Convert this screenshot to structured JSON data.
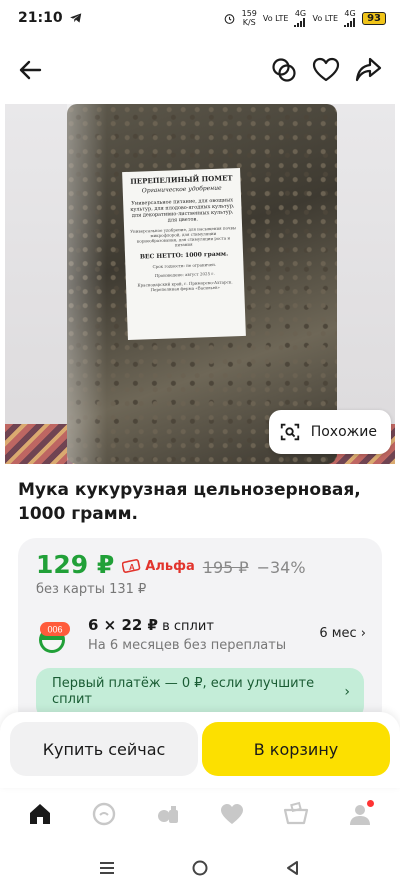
{
  "status_bar": {
    "time": "21:10",
    "net_speed": "159",
    "net_unit": "K/S",
    "sim1": "Vo LTE",
    "sim1_gen": "4G",
    "sim2": "Vo LTE",
    "sim2_gen": "4G",
    "battery": "93"
  },
  "header": {
    "back_icon": "arrow-left-icon",
    "compare_icon": "compare-icon",
    "favorite_icon": "heart-icon",
    "share_icon": "share-icon"
  },
  "product_image": {
    "label_title": "ПЕРЕПЕЛИНЫЙ ПОМЕТ",
    "label_subtitle": "Органическое удобрение",
    "label_body": "Универсальное питание, для овощных культур, для плодово-ягодных культур, для декоративно-лиственных культур, для цветов.",
    "label_small": "Универсальное удобрение, для насыщения почвы микрофлорой, для стимуляции корнеобразования, для стимуляции роста и питания",
    "label_net": "ВЕС НЕТТО: 1000 грамм.",
    "label_storage": "Срок годности: не ограничен.",
    "label_produced": "Произведено: август 2025 г.",
    "label_address": "Краснодарский край, г. Приморско-Ахтарск. Перепелиная ферма «Васильев»",
    "similar_label": "Похожие"
  },
  "product": {
    "title": "Мука кукурузная цельнозерновая, 1000 грамм."
  },
  "price": {
    "current": "129 ₽",
    "bank": "Альфа",
    "old": "195 ₽",
    "discount": "−34%",
    "without_card": "без карты 131 ₽"
  },
  "split": {
    "badge": "006",
    "title_amount": "6 × 22 ₽",
    "title_suffix": " в сплит",
    "subtitle": "На 6 месяцев без переплаты",
    "months": "6 мес ›"
  },
  "banner": {
    "text": "Первый платёж — 0 ₽, если улучшите сплит",
    "chevron": "›"
  },
  "actions": {
    "buy_now": "Купить сейчас",
    "add_to_cart": "В корзину"
  },
  "tabs": [
    "home-icon",
    "alice-icon",
    "catalog-icon",
    "favorites-icon",
    "cart-icon",
    "profile-icon"
  ],
  "colors": {
    "price_green": "#21a038",
    "cart_yellow": "#fce000",
    "banner_green": "#c4edd8",
    "alfa_red": "#e2342d"
  }
}
